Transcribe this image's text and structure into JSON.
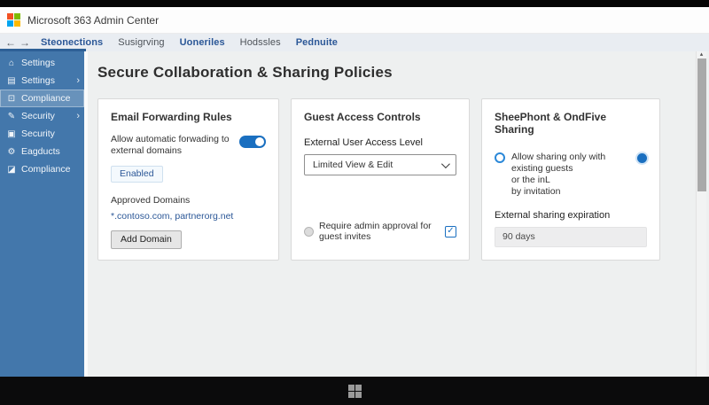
{
  "window": {
    "title": "Microsoft 363 Admin Center"
  },
  "nav": {
    "back_icon": "←",
    "forward_icon": "→",
    "tabs": [
      {
        "label": "Steonections",
        "active": true,
        "style": "blue"
      },
      {
        "label": "Susigrving",
        "active": false,
        "style": "gray"
      },
      {
        "label": "Uoneriles",
        "active": false,
        "style": "blue"
      },
      {
        "label": "Hodssles",
        "active": false,
        "style": "gray"
      },
      {
        "label": "Pednuite",
        "active": false,
        "style": "blue"
      }
    ]
  },
  "sidebar": {
    "items": [
      {
        "label": "Settings",
        "icon": "home-icon",
        "glyph": "⌂",
        "chevron": ""
      },
      {
        "label": "Settings",
        "icon": "list-icon",
        "glyph": "▤",
        "chevron": "›"
      },
      {
        "label": "Compliance",
        "icon": "clipboard-icon",
        "glyph": "⊡",
        "chevron": "",
        "selected": true
      },
      {
        "label": "Security",
        "icon": "pencil-icon",
        "glyph": "✎",
        "chevron": "›"
      },
      {
        "label": "Security",
        "icon": "document-icon",
        "glyph": "▣",
        "chevron": ""
      },
      {
        "label": "Eagducts",
        "icon": "gear-icon",
        "glyph": "⚙",
        "chevron": ""
      },
      {
        "label": "Compliance",
        "icon": "edit-square-icon",
        "glyph": "◪",
        "chevron": ""
      }
    ]
  },
  "page": {
    "title": "Secure Collaboration & Sharing Policies"
  },
  "cards": {
    "email_forwarding": {
      "title": "Email Forwarding Rules",
      "toggle_label": "Allow automatic forwading to external domains",
      "toggle_state": "on",
      "status_badge": "Enabled",
      "approved_domains_label": "Approved Domains",
      "approved_domains_value": "*.contoso.com, partnerorg.net",
      "add_domain_button": "Add Domain"
    },
    "guest_access": {
      "title": "Guest Access Controls",
      "access_level_label": "External User Access Level",
      "access_level_value": "Limited View & Edit",
      "approval_label": "Require admin approval for guest invites",
      "approval_checked": true
    },
    "sharing": {
      "title": "SheePhont & OndFive Sharing",
      "option_line1": "Allow sharing only with existing guests",
      "option_line2": "or the inL",
      "option_line3": "by invitation",
      "expiration_label": "External sharing expiration",
      "expiration_value": "90 days"
    }
  },
  "icons": {
    "check_glyph": "✓",
    "scroll_up_glyph": "▴"
  },
  "colors": {
    "accent-blue": "#2b5797",
    "toggle-blue": "#1a6fc0",
    "sidebar-bg": "#4377ab",
    "content-bg": "#eef0f0",
    "navbar-bg": "#e9edf2",
    "underline": "#2d6096",
    "taskbar-bg": "#0b0b0c",
    "card-border": "#d9d9d9",
    "ms-red": "#f25022",
    "ms-green": "#7fba00",
    "ms-blue": "#00a4ef",
    "ms-yellow": "#ffb900"
  }
}
